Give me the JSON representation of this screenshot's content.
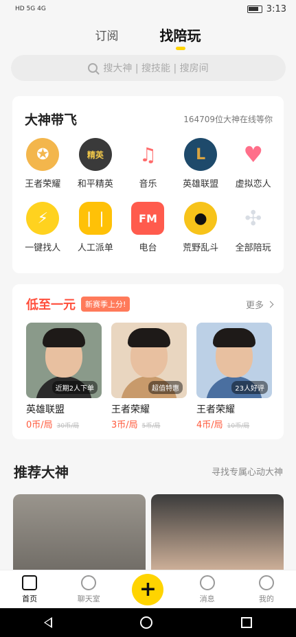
{
  "status": {
    "left": "HD 5G 4G",
    "time": "3:13"
  },
  "tabs": [
    {
      "label": "订阅",
      "active": false
    },
    {
      "label": "找陪玩",
      "active": true
    }
  ],
  "search": {
    "placeholder": "搜大神 | 搜技能 | 搜房间"
  },
  "section_top": {
    "title": "大神带飞",
    "subtitle": "164709位大神在线等你",
    "items": [
      {
        "label": "王者荣耀",
        "icon": "honor-of-kings-icon",
        "color": "#f3b64c"
      },
      {
        "label": "和平精英",
        "icon": "peace-elite-icon",
        "color": "#3a3a3a"
      },
      {
        "label": "音乐",
        "icon": "gramophone-icon",
        "color": "#ff6b6b"
      },
      {
        "label": "英雄联盟",
        "icon": "lol-icon",
        "color": "#d9a441"
      },
      {
        "label": "虚拟恋人",
        "icon": "hearts-icon",
        "color": "#ff6f8a"
      },
      {
        "label": "一键找人",
        "icon": "lightning-icon",
        "color": "#ffd21f"
      },
      {
        "label": "人工派单",
        "icon": "dispatch-icon",
        "color": "#ffc107"
      },
      {
        "label": "电台",
        "icon": "radio-icon",
        "color": "#ff5b4d"
      },
      {
        "label": "荒野乱斗",
        "icon": "brawl-stars-icon",
        "color": "#f7c31a"
      },
      {
        "label": "全部陪玩",
        "icon": "all-grid-icon",
        "color": "#e6e9ee"
      }
    ]
  },
  "section_deals": {
    "title": "低至一元",
    "tag": "新赛季上分!",
    "more": "更多",
    "items": [
      {
        "game": "英雄联盟",
        "price": "0币/局",
        "old": "30币/局",
        "badge": "近期2人下单",
        "shirt": "#2b2b2b",
        "bg": "#8a9a8a"
      },
      {
        "game": "王者荣耀",
        "price": "3币/局",
        "old": "5币/局",
        "badge": "超值特惠",
        "shirt": "#c89a6b",
        "bg": "#e9d6c0"
      },
      {
        "game": "王者荣耀",
        "price": "4币/局",
        "old": "10币/局",
        "badge": "23人好评",
        "shirt": "#4a6fa0",
        "bg": "#bcd0e6"
      }
    ]
  },
  "section_rec": {
    "title": "推荐大神",
    "subtitle": "寻找专属心动大神"
  },
  "bottom_nav": [
    {
      "label": "首页",
      "active": true
    },
    {
      "label": "聊天室",
      "active": false
    },
    {
      "label": "",
      "active": false
    },
    {
      "label": "消息",
      "active": false
    },
    {
      "label": "我的",
      "active": false
    }
  ]
}
